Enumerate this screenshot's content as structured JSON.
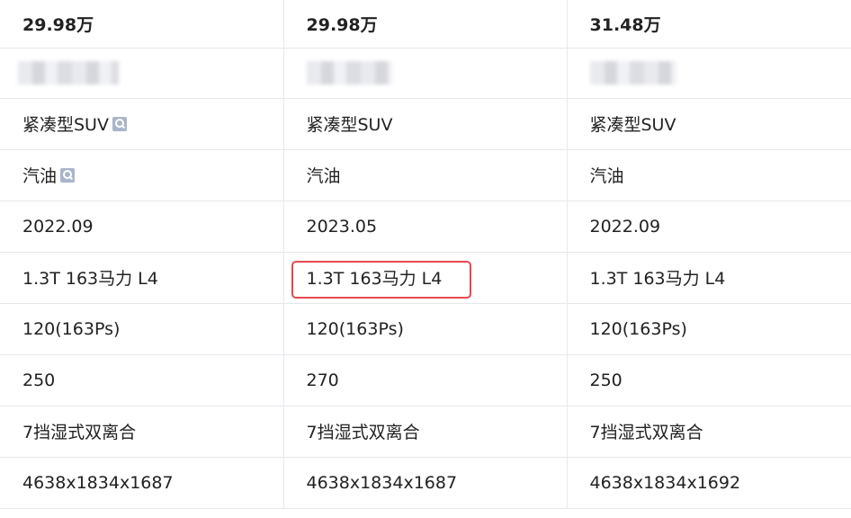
{
  "highlight_color": "#e8474f",
  "rows": [
    {
      "name": "price-row",
      "cells": [
        "29.98万",
        "29.98万",
        "31.48万"
      ]
    },
    {
      "name": "blurred-row",
      "cells": [
        "",
        "",
        ""
      ]
    },
    {
      "name": "class-row",
      "cells": [
        "紧凑型SUV",
        "紧凑型SUV",
        "紧凑型SUV"
      ]
    },
    {
      "name": "fuel-row",
      "cells": [
        "汽油",
        "汽油",
        "汽油"
      ]
    },
    {
      "name": "launch-date-row",
      "cells": [
        "2022.09",
        "2023.05",
        "2022.09"
      ]
    },
    {
      "name": "engine-row",
      "cells": [
        "1.3T 163马力 L4",
        "1.3T 163马力 L4",
        "1.3T 163马力 L4"
      ]
    },
    {
      "name": "power-row",
      "cells": [
        "120(163Ps)",
        "120(163Ps)",
        "120(163Ps)"
      ]
    },
    {
      "name": "torque-row",
      "cells": [
        "250",
        "270",
        "250"
      ]
    },
    {
      "name": "transmission-row",
      "cells": [
        "7挡湿式双离合",
        "7挡湿式双离合",
        "7挡湿式双离合"
      ]
    },
    {
      "name": "dimensions-row",
      "cells": [
        "4638x1834x1687",
        "4638x1834x1687",
        "4638x1834x1692"
      ]
    }
  ],
  "icons": {
    "class_row_col1": "search-icon",
    "fuel_row_col1": "search-icon"
  }
}
